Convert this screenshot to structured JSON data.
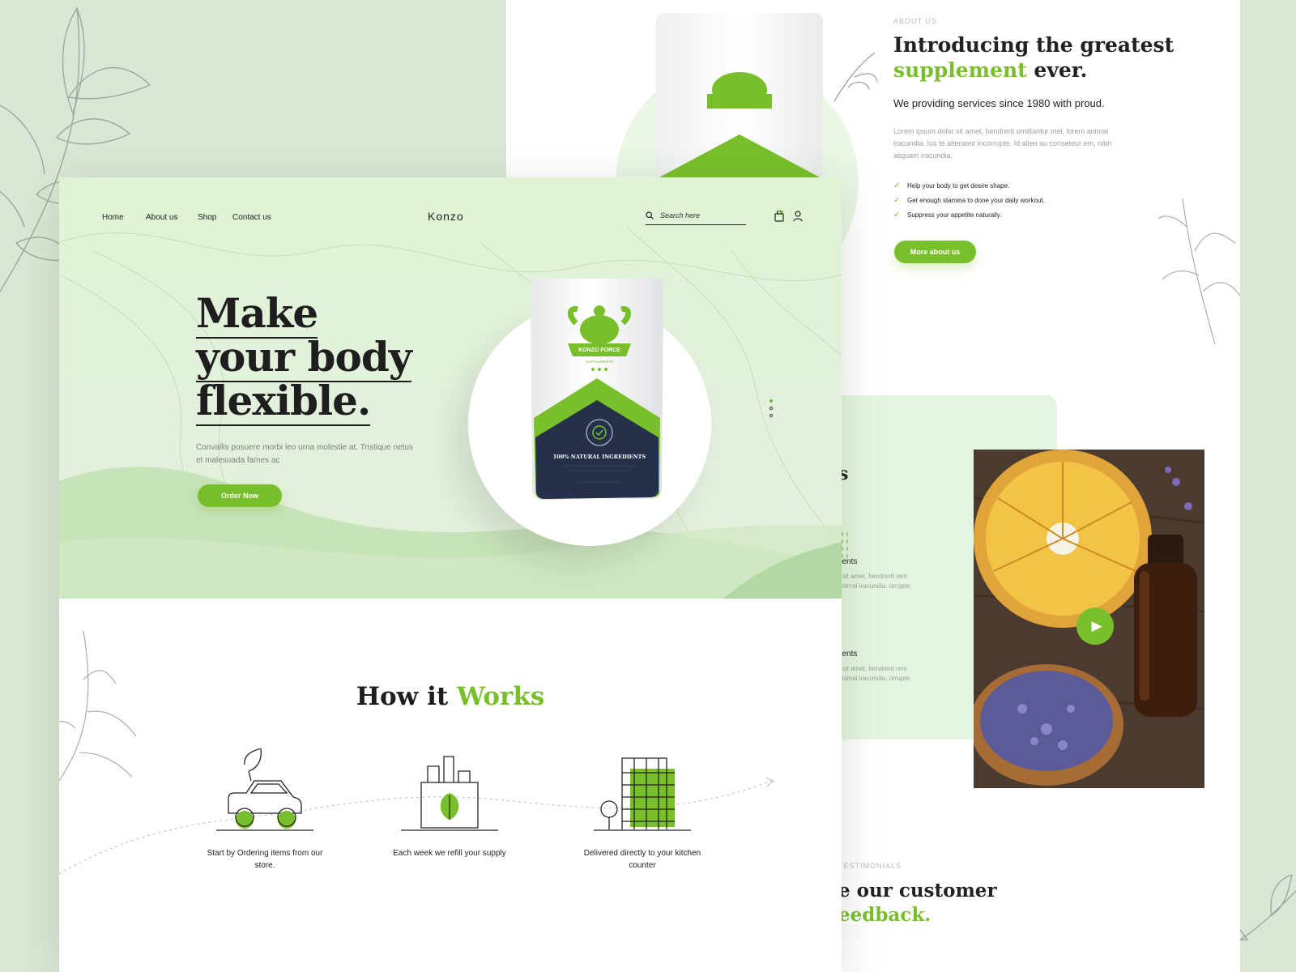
{
  "front": {
    "nav": {
      "items": [
        "Home",
        "About us",
        "Shop",
        "Contact us"
      ],
      "logo": "Konzo",
      "search_placeholder": "Search here"
    },
    "hero": {
      "title_lines": [
        "Make",
        "your body",
        "flexible."
      ],
      "description": "Convallis posuere morbi leo urna molestie at. Tristique netus et malesuada fames ac",
      "cta_label": "Order Now",
      "pouch_brand": "KONZO FORCE",
      "pouch_sub": "SUPPLEMENTS",
      "pouch_tag": "100% NATURAL INGREDIENTS"
    },
    "how": {
      "title_main": "How it ",
      "title_accent": "Works",
      "steps": [
        "Start by Ordering items from our store.",
        "Each week we refill your supply",
        "Delivered directly to your kitchen counter"
      ]
    }
  },
  "back": {
    "about": {
      "kicker": "ABOUT US",
      "title_line1": "Introducing the greatest",
      "title_accent": "supplement",
      "title_end": " ever.",
      "subtitle": "We  providing services since 1980 with proud.",
      "body": "Lorem ipsum dolor sit amet, hendrerit omittantur mel, lorem animal iracundia. Ius te alteraent incorrupte. Id alien au conseteur em, nibh aliquam iracundia.",
      "bullets": [
        "Help your body to get desire shape.",
        "Get enough stamina to done your daily workout.",
        "Suppress your appetite naturally."
      ],
      "cta_label": "More about us"
    },
    "ingredients": {
      "heading_fragment": "s",
      "items": [
        {
          "title": "lients",
          "text": "r sit amet, hendrerit rem animal iracundia. orrupte."
        },
        {
          "title": "lients",
          "text": "r sit amet, hendrerit rem animal iracundia. orrupte."
        }
      ]
    },
    "testimonials": {
      "kicker": "TESTIMONIALS",
      "title_line1": "e our customer",
      "title_accent": "eedback."
    }
  },
  "colors": {
    "accent": "#79bf2b",
    "background": "#dbe7d6",
    "hero_bg": "#e3f1dc",
    "dark_text": "#1e1e1e",
    "pouch_navy": "#25304a"
  }
}
